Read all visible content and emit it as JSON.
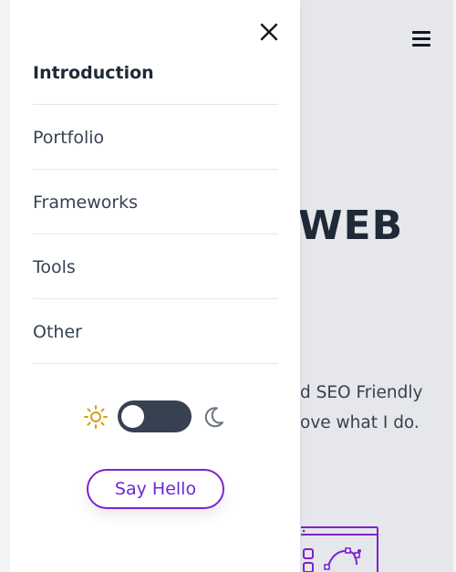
{
  "background_page": {
    "hero_fragment": "WEB",
    "description_line_1": "d SEO Friendly",
    "description_line_2": "ove what I do."
  },
  "drawer": {
    "nav_items": [
      {
        "label": "Introduction",
        "active": true
      },
      {
        "label": "Portfolio",
        "active": false
      },
      {
        "label": "Frameworks",
        "active": false
      },
      {
        "label": "Tools",
        "active": false
      },
      {
        "label": "Other",
        "active": false
      }
    ],
    "theme_toggle": {
      "state": "light"
    },
    "cta_label": "Say Hello"
  },
  "colors": {
    "accent": "#7e22ce",
    "sun": "#d4a017",
    "toggle_track": "#374151",
    "backdrop": "#e5e7eb"
  },
  "icons": [
    "close-icon",
    "hamburger-menu-icon",
    "sun-icon",
    "moon-icon"
  ]
}
